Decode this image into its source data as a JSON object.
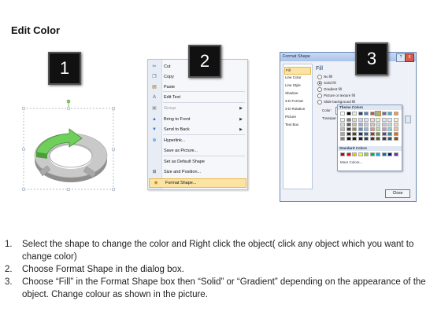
{
  "title": "Edit Color",
  "badges": [
    "1",
    "2",
    "3"
  ],
  "context_menu": {
    "items": [
      {
        "icon": "cut-icon",
        "label": "Cut",
        "disabled": false,
        "submenu": false
      },
      {
        "icon": "copy-icon",
        "label": "Copy",
        "disabled": false,
        "submenu": false
      },
      {
        "icon": "paste-icon",
        "label": "Paste",
        "disabled": false,
        "submenu": false
      },
      {
        "icon": "edit-text-icon",
        "label": "Edit Text",
        "disabled": false,
        "submenu": false
      },
      {
        "icon": "group-icon",
        "label": "Group",
        "disabled": true,
        "submenu": true
      },
      {
        "icon": "bring-to-front-icon",
        "label": "Bring to Front",
        "disabled": false,
        "submenu": true
      },
      {
        "icon": "send-to-back-icon",
        "label": "Send to Back",
        "disabled": false,
        "submenu": true
      },
      {
        "icon": "hyperlink-icon",
        "label": "Hyperlink...",
        "disabled": false,
        "submenu": false
      },
      {
        "icon": "",
        "label": "Save as Picture...",
        "disabled": false,
        "submenu": false
      },
      {
        "icon": "",
        "label": "Set as Default Shape",
        "disabled": false,
        "submenu": false
      },
      {
        "icon": "size-position-icon",
        "label": "Size and Position...",
        "disabled": false,
        "submenu": false
      },
      {
        "icon": "format-shape-icon",
        "label": "Format Shape...",
        "disabled": false,
        "submenu": false,
        "highlighted": true
      }
    ]
  },
  "dialog": {
    "title": "Format Shape",
    "nav": [
      "Fill",
      "Line Color",
      "Line Style",
      "Shadow",
      "3-D Format",
      "3-D Rotation",
      "Picture",
      "Text Box"
    ],
    "fill_heading": "Fill",
    "options": [
      "No fill",
      "Solid fill",
      "Gradient fill",
      "Picture or texture fill",
      "Slide background fill"
    ],
    "color_label": "Color:",
    "transparency_label": "Transpar",
    "theme_colors_label": "Theme Colors",
    "standard_colors_label": "Standard Colors",
    "more_colors_label": "More Colors...",
    "close_label": "Close",
    "help_label": "?",
    "x_label": "X",
    "theme_top": [
      "#ffffff",
      "#000000",
      "#eeece1",
      "#1f497d",
      "#4f81bd",
      "#c0504d",
      "#9bbb59",
      "#8064a2",
      "#4bacc6",
      "#f79646"
    ],
    "theme_cols": [
      [
        "#f2f2f2",
        "#d8d8d8",
        "#bfbfbf",
        "#a5a5a5",
        "#7f7f7f"
      ],
      [
        "#7f7f7f",
        "#595959",
        "#3f3f3f",
        "#262626",
        "#0c0c0c"
      ],
      [
        "#ddd9c3",
        "#c4bd97",
        "#938953",
        "#494429",
        "#1d1b10"
      ],
      [
        "#c6d9f0",
        "#8db3e2",
        "#548dd4",
        "#17365d",
        "#0f243e"
      ],
      [
        "#dbe5f1",
        "#b8cce4",
        "#95b3d7",
        "#366092",
        "#244061"
      ],
      [
        "#f2dcdb",
        "#e5b9b7",
        "#d99694",
        "#953734",
        "#632423"
      ],
      [
        "#ebf1dd",
        "#d7e3bc",
        "#c3d69b",
        "#76923c",
        "#4f6128"
      ],
      [
        "#e5e0ec",
        "#ccc1d9",
        "#b2a2c7",
        "#5f497a",
        "#3f3151"
      ],
      [
        "#dbeef3",
        "#b7dde8",
        "#92cddc",
        "#31859b",
        "#205867"
      ],
      [
        "#fdeada",
        "#fbd5b5",
        "#fac08f",
        "#e36c09",
        "#974806"
      ]
    ],
    "standard": [
      "#c00000",
      "#ff0000",
      "#ffc000",
      "#ffff00",
      "#92d050",
      "#00b050",
      "#00b0f0",
      "#0070c0",
      "#002060",
      "#7030a0"
    ],
    "selected_color": "#9bbb59"
  },
  "instructions": [
    {
      "num": "1.",
      "text": "Select the shape to change the color and Right click the object( click any object which you want to change color)"
    },
    {
      "num": "2.",
      "text": "Choose Format Shape in the dialog box."
    },
    {
      "num": "3.",
      "text": "Choose “Fill” in the Format Shape box then “Solid” or “Gradient” depending on the appearance of the object. Change colour as shown in the picture."
    }
  ]
}
